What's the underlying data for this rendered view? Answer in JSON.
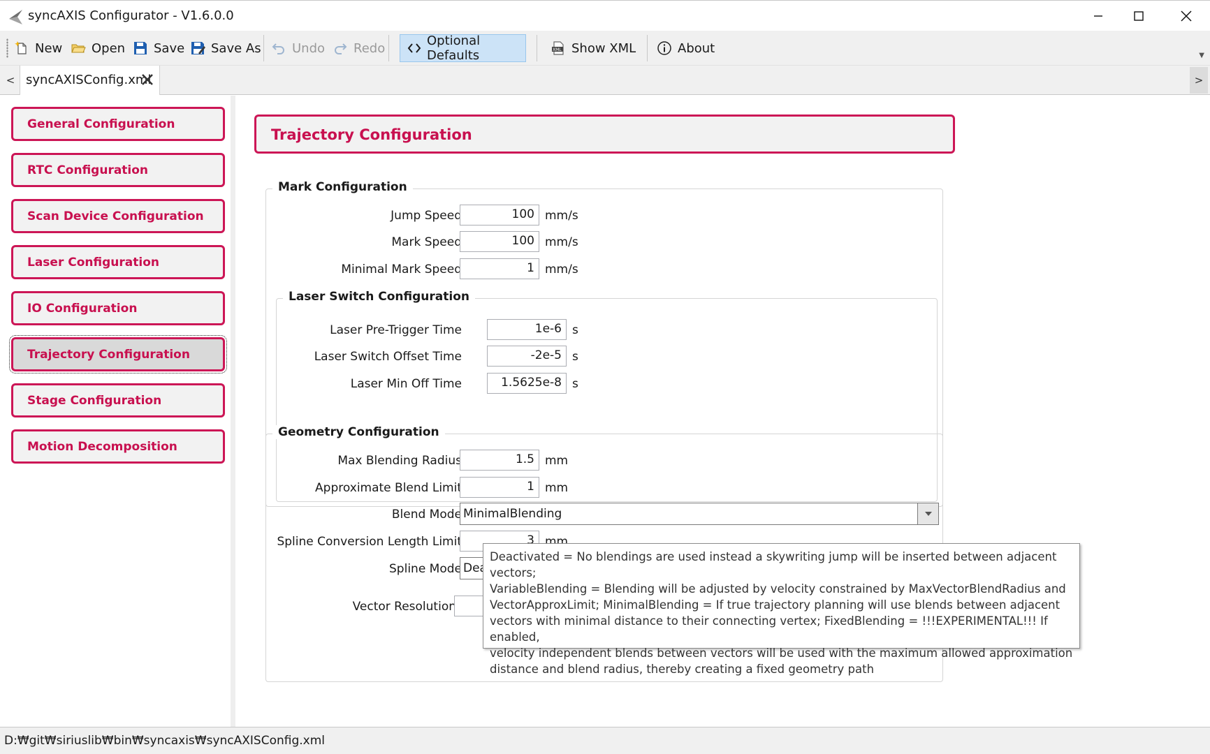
{
  "window": {
    "title": "syncAXIS Configurator - V1.6.0.0",
    "minimize_label": "Minimize",
    "maximize_label": "Maximize",
    "close_label": "Close"
  },
  "toolbar": {
    "items": [
      {
        "label": "New",
        "icon": "new-file-icon"
      },
      {
        "label": "Open",
        "icon": "folder-open-icon"
      },
      {
        "label": "Save",
        "icon": "save-icon"
      },
      {
        "label": "Save As",
        "icon": "save-as-icon"
      },
      {
        "label": "Undo",
        "icon": "undo-icon",
        "enabled": false
      },
      {
        "label": "Redo",
        "icon": "redo-icon",
        "enabled": false
      },
      {
        "label": "Optional Defaults",
        "icon": "code-brackets-icon",
        "active": true
      },
      {
        "label": "Show XML",
        "icon": "xml-icon"
      },
      {
        "label": "About",
        "icon": "info-icon"
      }
    ]
  },
  "tabs": [
    {
      "label": "syncAXISConfig.xml",
      "active": true
    }
  ],
  "sidebar": {
    "items": [
      {
        "label": "General Configuration"
      },
      {
        "label": "RTC Configuration"
      },
      {
        "label": "Scan Device Configuration"
      },
      {
        "label": "Laser Configuration"
      },
      {
        "label": "IO Configuration"
      },
      {
        "label": "Trajectory Configuration",
        "selected": true
      },
      {
        "label": "Stage Configuration"
      },
      {
        "label": "Motion Decomposition"
      }
    ]
  },
  "main": {
    "title": "Trajectory Configuration",
    "mark": {
      "header": "Mark Configuration",
      "jump_speed": {
        "label": "Jump Speed",
        "value": "100",
        "unit": "mm/s"
      },
      "mark_speed": {
        "label": "Mark Speed",
        "value": "100",
        "unit": "mm/s"
      },
      "min_mark_speed": {
        "label": "Minimal Mark Speed",
        "value": "1",
        "unit": "mm/s"
      }
    },
    "laser_switch": {
      "header": "Laser Switch Configuration",
      "pre_trigger": {
        "label": "Laser Pre-Trigger Time",
        "value": "1e-6",
        "unit": "s"
      },
      "switch_offset": {
        "label": "Laser Switch Offset Time",
        "value": "-2e-5",
        "unit": "s"
      },
      "min_off": {
        "label": "Laser Min Off Time",
        "value": "1.5625e-8",
        "unit": "s"
      }
    },
    "geometry": {
      "header": "Geometry Configuration",
      "max_blend_radius": {
        "label": "Max Blending Radius",
        "value": "1.5",
        "unit": "mm"
      },
      "approx_blend_limit": {
        "label": "Approximate Blend Limit",
        "value": "1",
        "unit": "mm"
      },
      "blend_mode": {
        "label": "Blend Mode",
        "value": "MinimalBlending"
      },
      "spline_length": {
        "label": "Spline Conversion Length Limit",
        "value": "3",
        "unit": "mm"
      },
      "spline_mode": {
        "label": "Spline Mode",
        "value": "Dea"
      }
    },
    "vector_resolution": {
      "label": "Vector Resolution",
      "value": ""
    }
  },
  "tooltip": {
    "lines": [
      "Deactivated = No blendings are used instead a skywriting jump will be inserted between adjacent vectors;",
      "VariableBlending = Blending will be adjusted by velocity constrained by MaxVectorBlendRadius and",
      "VectorApproxLimit; MinimalBlending  = If true trajectory planning will use blends between adjacent",
      "vectors with minimal distance to their connecting vertex; FixedBlending = !!!EXPERIMENTAL!!! If enabled,",
      "velocity independent blends between vectors will be used with the maximum allowed approximation",
      "distance and blend radius, thereby creating a fixed geometry path"
    ]
  },
  "status": {
    "path": "D:₩git₩siriuslib₩bin₩syncaxis₩syncAXISConfig.xml"
  },
  "colors": {
    "accent": "#c8104f",
    "selected_toolbar_bg": "#cce3f7",
    "toolbar_bg": "#f0f0f0"
  }
}
